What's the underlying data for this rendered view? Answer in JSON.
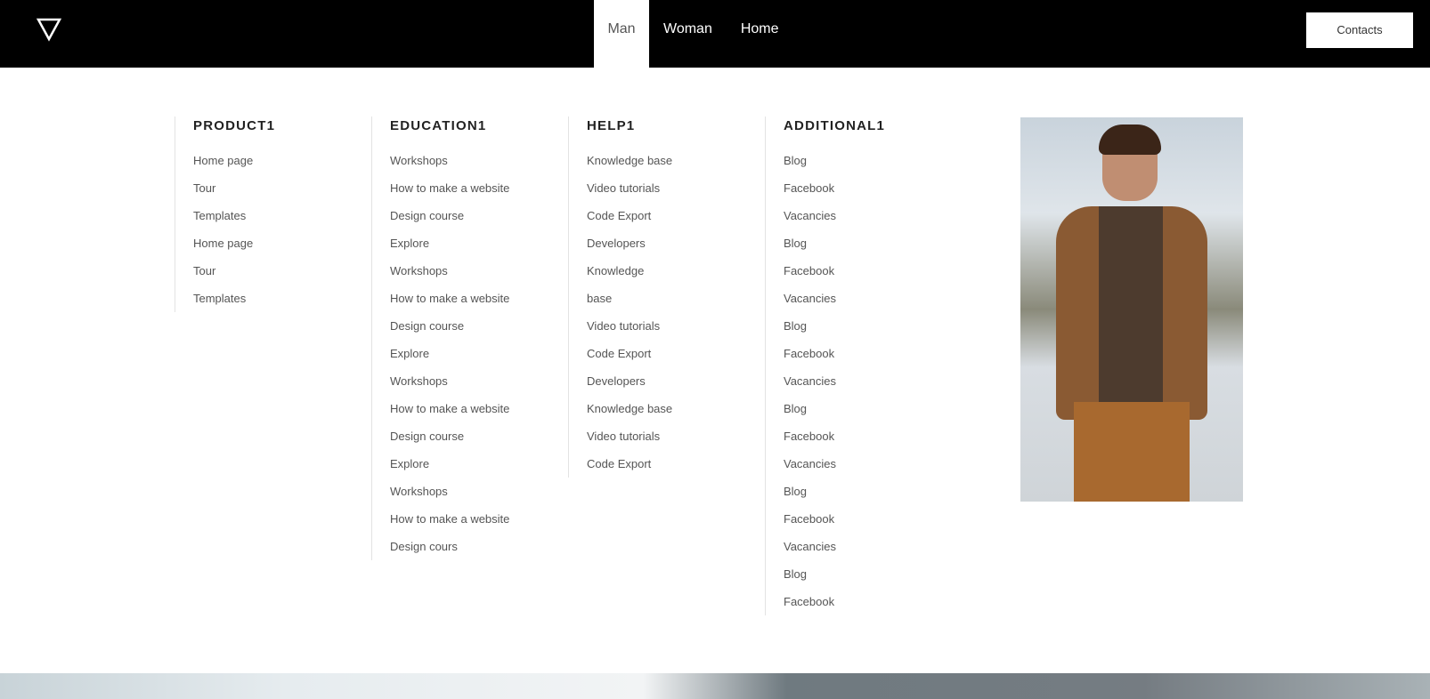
{
  "header": {
    "nav": [
      "Man",
      "Woman",
      "Home"
    ],
    "active": "Man",
    "contacts_label": "Contacts"
  },
  "menu": {
    "columns": [
      {
        "title": "PRODUCT1",
        "items": [
          "Home page",
          "Tour",
          "Templates",
          "Home page",
          "Tour",
          "Templates"
        ]
      },
      {
        "title": "EDUCATION1",
        "items": [
          "Workshops",
          "How to make a website",
          "Design course",
          "Explore",
          "Workshops",
          "How to make a website",
          "Design course",
          "Explore",
          "Workshops",
          "How to make a website",
          "Design course",
          "Explore",
          "Workshops",
          "How to make a website",
          "Design cours"
        ]
      },
      {
        "title": "HELP1",
        "items": [
          "Knowledge base",
          "Video tutorials",
          "Code Export",
          "Developers",
          "Knowledge",
          "base",
          "Video tutorials",
          "Code Export",
          "Developers",
          "Knowledge base",
          "Video tutorials",
          "Code Export"
        ]
      },
      {
        "title": "ADDITIONAL1",
        "items": [
          "Blog",
          "Facebook",
          "Vacancies",
          "Blog",
          "Facebook",
          "Vacancies",
          "Blog",
          "Facebook",
          "Vacancies",
          "Blog",
          "Facebook",
          "Vacancies",
          "Blog",
          "Facebook",
          "Vacancies",
          "Blog",
          "Facebook"
        ]
      }
    ]
  }
}
